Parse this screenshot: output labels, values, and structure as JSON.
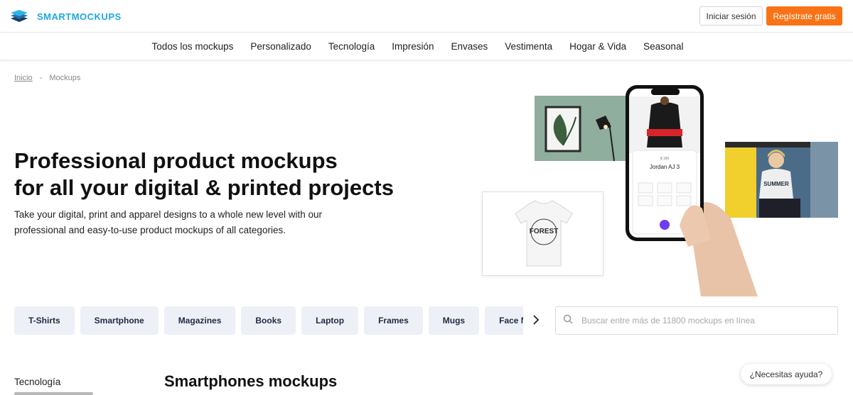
{
  "header": {
    "brand": "SMARTMOCKUPS",
    "login_label": "Iniciar sesión",
    "signup_label": "Regístrate gratis"
  },
  "nav": {
    "items": [
      {
        "label": "Todos los mockups"
      },
      {
        "label": "Personalizado"
      },
      {
        "label": "Tecnología"
      },
      {
        "label": "Impresión"
      },
      {
        "label": "Envases"
      },
      {
        "label": "Vestimenta"
      },
      {
        "label": "Hogar & Vida"
      },
      {
        "label": "Seasonal"
      }
    ]
  },
  "breadcrumb": {
    "home": "Inicio",
    "separator": "-",
    "current": "Mockups"
  },
  "hero": {
    "title_line1": "Professional product mockups",
    "title_line2": "for all your digital & printed projects",
    "subtitle": "Take your digital, print and apparel designs to a whole new level with our professional and easy-to-use product mockups of all categories.",
    "phone_price": "$ 180",
    "phone_product": "Jordan AJ 3",
    "tee_print": "FOREST",
    "mug_print": "SUMMER"
  },
  "categories": {
    "items": [
      {
        "label": "T-Shirts"
      },
      {
        "label": "Smartphone"
      },
      {
        "label": "Magazines"
      },
      {
        "label": "Books"
      },
      {
        "label": "Laptop"
      },
      {
        "label": "Frames"
      },
      {
        "label": "Mugs"
      },
      {
        "label": "Face Masks"
      }
    ]
  },
  "search": {
    "placeholder": "Buscar entre más de 11800 mockups en línea"
  },
  "sidebar": {
    "heading": "Tecnología"
  },
  "main": {
    "section_title": "Smartphones mockups"
  },
  "help": {
    "label": "¿Necesitas ayuda?"
  },
  "colors": {
    "brand": "#1fa7e4",
    "cta": "#f97316",
    "chip_bg": "#eef0f7"
  },
  "icons": {
    "logo": "stacked-layers-icon",
    "search": "search-icon",
    "next": "chevron-right-icon"
  }
}
